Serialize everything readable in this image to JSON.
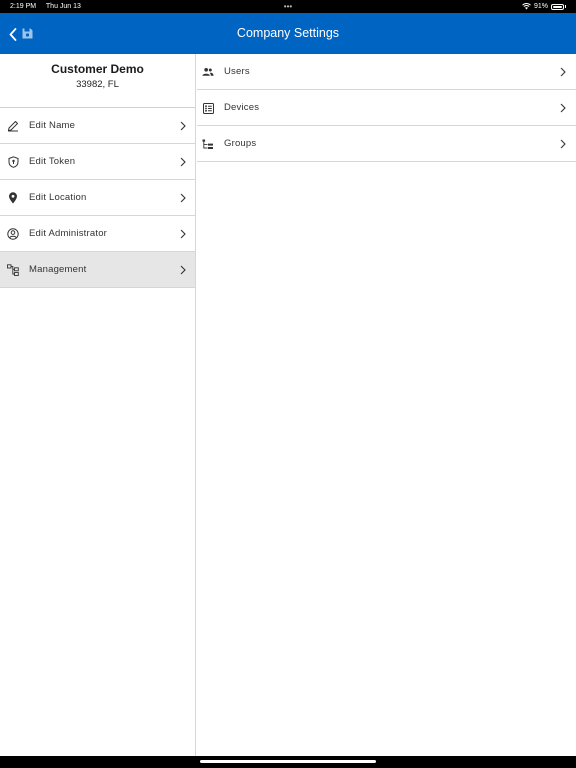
{
  "status_bar": {
    "time": "2:19 PM",
    "date": "Thu Jun 13",
    "dots": "•••",
    "battery": "91%"
  },
  "nav": {
    "title": "Company Settings",
    "back_icon": "chevron-left-icon",
    "save_icon": "floppy-disk-icon"
  },
  "profile": {
    "name": "Customer Demo",
    "subtitle": "33982, FL"
  },
  "left_menu": {
    "items": [
      {
        "label": "Edit Name",
        "icon": "pencil-icon"
      },
      {
        "label": "Edit Token",
        "icon": "shield-icon"
      },
      {
        "label": "Edit Location",
        "icon": "location-pin-icon"
      },
      {
        "label": "Edit Administrator",
        "icon": "user-circle-icon"
      },
      {
        "label": "Management",
        "icon": "hierarchy-icon",
        "selected": true
      }
    ]
  },
  "right_menu": {
    "items": [
      {
        "label": "Users",
        "icon": "people-icon"
      },
      {
        "label": "Devices",
        "icon": "device-list-icon"
      },
      {
        "label": "Groups",
        "icon": "tree-icon"
      }
    ]
  },
  "colors": {
    "nav_background": "#0064c3",
    "selected_row": "#e6e6e6",
    "divider": "#d6d6d6"
  }
}
